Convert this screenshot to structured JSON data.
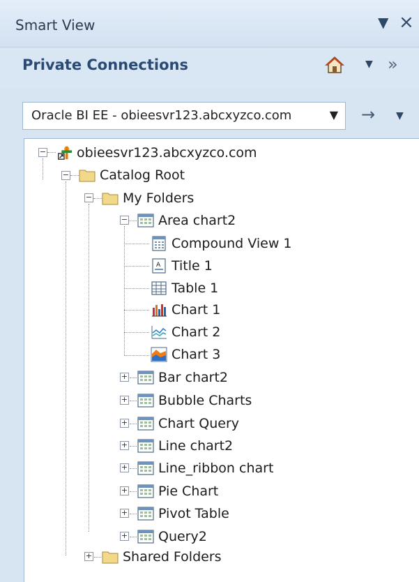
{
  "pane": {
    "title": "Smart View",
    "dropdown_glyph": "▼",
    "close_glyph": "×"
  },
  "header": {
    "title": "Private Connections",
    "home_icon": "home-icon",
    "menu_glyph": "▼",
    "more_glyph": "»"
  },
  "connection": {
    "selected": "Oracle BI EE - obieesvr123.abcxyzco.com",
    "arrow_glyph": "→",
    "menu_glyph": "▼"
  },
  "tree": {
    "server": "obieesvr123.abcxyzco.com",
    "catalog_root": "Catalog Root",
    "my_folders": "My Folders",
    "area_chart": "Area chart2",
    "views": [
      {
        "label": "Compound View 1",
        "icon": "compound-view-icon"
      },
      {
        "label": "Title 1",
        "icon": "title-view-icon"
      },
      {
        "label": "Table 1",
        "icon": "table-view-icon"
      },
      {
        "label": "Chart 1",
        "icon": "bar-chart-icon"
      },
      {
        "label": "Chart 2",
        "icon": "line-chart-icon"
      },
      {
        "label": "Chart 3",
        "icon": "area-chart-icon"
      }
    ],
    "analyses": [
      "Bar chart2",
      "Bubble Charts",
      "Chart Query",
      "Line chart2",
      "Line_ribbon chart",
      "Pie Chart",
      "Pivot Table",
      "Query2"
    ],
    "shared_folders": "Shared Folders",
    "expand_glyph": "+",
    "collapse_glyph": "−"
  },
  "colors": {
    "pane_bg": "#d7e4f2",
    "header_text": "#2a4a75",
    "folder_fill": "#f2d98a",
    "tree_bg": "#ffffff"
  }
}
